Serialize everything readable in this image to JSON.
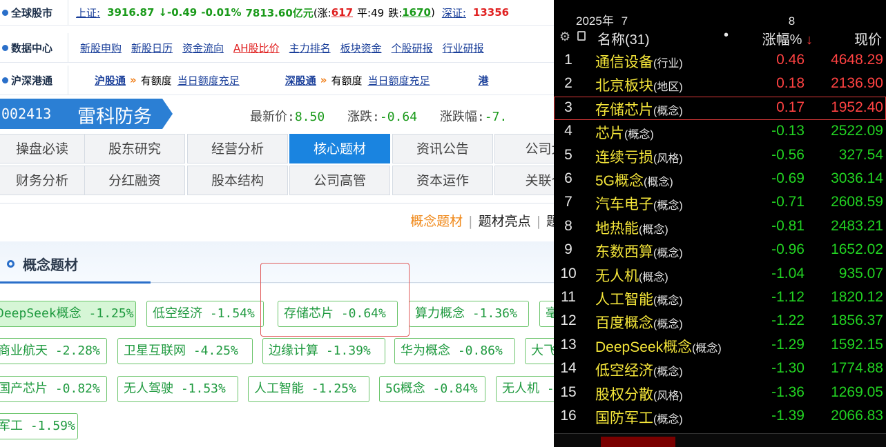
{
  "quote_row": {
    "label": "全球股市",
    "index_name": "上证:",
    "index_value": "3916.87",
    "arrow": "↓",
    "change": "-0.49",
    "change_pct": "-0.01%",
    "volume": "7813.60亿元",
    "up_label": "(涨:",
    "up_count": "617",
    "flat_label": "平:49",
    "down_label": "跌:",
    "down_count": "1670",
    "close": ")",
    "index2_name": "深证:",
    "index2_value": "13356"
  },
  "data_center": {
    "label": "数据中心",
    "links": [
      "新股申购",
      "新股日历",
      "资金流向",
      "AH股比价",
      "主力排名",
      "板块资金",
      "个股研报",
      "行业研报"
    ]
  },
  "connect": {
    "label": "沪深港通",
    "sh_link": "沪股通",
    "sh_quota": "有额度",
    "sh_status": "当日额度充足",
    "sz_link": "深股通",
    "sz_quota": "有额度",
    "sz_status": "当日额度充足",
    "hk_link": "港"
  },
  "stock": {
    "code": "002413",
    "name": "雷科防务",
    "price_label": "最新价:",
    "price": "8.50",
    "change_label": "涨跌:",
    "change": "-0.64",
    "pct_label": "涨跌幅:",
    "pct": "-7."
  },
  "tabs_row1": [
    "操盘必读",
    "股东研究",
    "经营分析",
    "核心题材",
    "资讯公告",
    "公司大"
  ],
  "tabs_row2": [
    "财务分析",
    "分红融资",
    "股本结构",
    "公司高管",
    "资本运作",
    "关联个"
  ],
  "active_tab": "核心题材",
  "subtabs": [
    "概念题材",
    "题材亮点",
    "题"
  ],
  "section_title": "概念题材",
  "tags": [
    {
      "text": "DeepSeek概念 -1.25%",
      "highlight": true
    },
    {
      "text": "低空经济 -1.54%"
    },
    {
      "text": "存储芯片 -0.64%"
    },
    {
      "text": "算力概念 -1.36%"
    },
    {
      "text": "毫"
    },
    {
      "text": "商业航天 -2.28%"
    },
    {
      "text": "卫星互联网 -4.25%"
    },
    {
      "text": "边缘计算 -1.39%"
    },
    {
      "text": "华为概念 -0.86%"
    },
    {
      "text": "大飞"
    },
    {
      "text": "国产芯片 -0.82%"
    },
    {
      "text": "无人驾驶 -1.53%"
    },
    {
      "text": "人工智能 -1.25%"
    },
    {
      "text": "5G概念 -0.84%"
    },
    {
      "text": "无人机 -"
    },
    {
      "text": "军工 -1.59%"
    }
  ],
  "panel": {
    "date_year": "2025年",
    "date_a": "7",
    "date_b": "8",
    "header_name": "名称(31)",
    "header_dot": "•",
    "header_change": "涨幅%",
    "header_arrow": "↓",
    "header_price": "现价",
    "colors": {
      "up": "#ff4242",
      "down": "#22d322",
      "name": "#f5e63a",
      "selected_border": "#e03b3b"
    },
    "rows": [
      {
        "idx": "1",
        "name": "通信设备",
        "cat": "(行业)",
        "change": "0.46",
        "price": "4648.29",
        "dir": "up"
      },
      {
        "idx": "2",
        "name": "北京板块",
        "cat": "(地区)",
        "change": "0.18",
        "price": "2136.90",
        "dir": "up"
      },
      {
        "idx": "3",
        "name": "存储芯片",
        "cat": "(概念)",
        "change": "0.17",
        "price": "1952.40",
        "dir": "up",
        "selected": true
      },
      {
        "idx": "4",
        "name": "芯片",
        "cat": "(概念)",
        "change": "-0.13",
        "price": "2522.09",
        "dir": "dn"
      },
      {
        "idx": "5",
        "name": "连续亏损",
        "cat": "(风格)",
        "change": "-0.56",
        "price": "327.54",
        "dir": "dn"
      },
      {
        "idx": "6",
        "name": "5G概念",
        "cat": "(概念)",
        "change": "-0.69",
        "price": "3036.14",
        "dir": "dn"
      },
      {
        "idx": "7",
        "name": "汽车电子",
        "cat": "(概念)",
        "change": "-0.71",
        "price": "2608.59",
        "dir": "dn"
      },
      {
        "idx": "8",
        "name": "地热能",
        "cat": "(概念)",
        "change": "-0.81",
        "price": "2483.21",
        "dir": "dn"
      },
      {
        "idx": "9",
        "name": "东数西算",
        "cat": "(概念)",
        "change": "-0.96",
        "price": "1652.02",
        "dir": "dn"
      },
      {
        "idx": "10",
        "name": "无人机",
        "cat": "(概念)",
        "change": "-1.04",
        "price": "935.07",
        "dir": "dn"
      },
      {
        "idx": "11",
        "name": "人工智能",
        "cat": "(概念)",
        "change": "-1.12",
        "price": "1820.12",
        "dir": "dn"
      },
      {
        "idx": "12",
        "name": "百度概念",
        "cat": "(概念)",
        "change": "-1.22",
        "price": "1856.37",
        "dir": "dn"
      },
      {
        "idx": "13",
        "name": "DeepSeek概念",
        "cat": "(概念)",
        "change": "-1.29",
        "price": "1592.15",
        "dir": "dn"
      },
      {
        "idx": "14",
        "name": "低空经济",
        "cat": "(概念)",
        "change": "-1.30",
        "price": "1774.88",
        "dir": "dn"
      },
      {
        "idx": "15",
        "name": "股权分散",
        "cat": "(风格)",
        "change": "-1.36",
        "price": "1269.05",
        "dir": "dn"
      },
      {
        "idx": "16",
        "name": "国防军工",
        "cat": "(概念)",
        "change": "-1.39",
        "price": "2066.83",
        "dir": "dn"
      }
    ]
  }
}
